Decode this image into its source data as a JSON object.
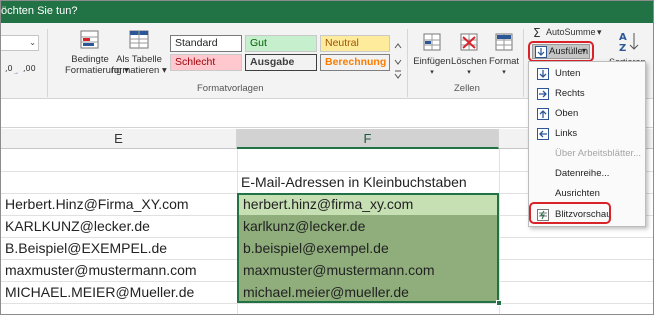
{
  "title_bar": {
    "tell_me_text": "öchten Sie tun?"
  },
  "ribbon": {
    "font_size_value": "",
    "number_format_buttons": [
      "⁰⁰→⁰",
      "⁰→⁰⁰"
    ],
    "conditional_formatting_label": "Bedingte\nFormatierung ▾",
    "format_as_table_label": "Als Tabelle\nformatieren ▾",
    "cell_styles": {
      "standard": "Standard",
      "gut": "Gut",
      "neutral": "Neutral",
      "schlecht": "Schlecht",
      "ausgabe": "Ausgabe",
      "berechnung": "Berechnung"
    },
    "formatvorlagen_label": "Formatvorlagen",
    "insert_label": "Einfügen",
    "delete_label": "Löschen",
    "format_label": "Format",
    "zellen_label": "Zellen",
    "autosum_label": "AutoSumme",
    "fill_label": "Ausfüllen",
    "sort_label": "Sortieren un",
    "colors": {
      "excel_green": "#217346",
      "gut_bg": "#c6efce",
      "gut_text": "#006100",
      "neutral_bg": "#ffeb9c",
      "neutral_text": "#9c5700",
      "schlecht_bg": "#ffc7ce",
      "schlecht_text": "#9c0006",
      "ausgabe_bg": "#f2f2f2",
      "berechnung_bg": "#f2f2f2",
      "berechnung_text": "#fa7d00",
      "highlight_red": "#d9232a"
    }
  },
  "fill_menu": {
    "items": [
      {
        "label": "Unten",
        "icon": "arrow-down-icon",
        "disabled": false
      },
      {
        "label": "Rechts",
        "icon": "arrow-right-icon",
        "disabled": false
      },
      {
        "label": "Oben",
        "icon": "arrow-up-icon",
        "disabled": false
      },
      {
        "label": "Links",
        "icon": "arrow-left-icon",
        "disabled": false
      },
      {
        "label": "Über Arbeitsblätter...",
        "icon": "",
        "disabled": true
      },
      {
        "label": "Datenreihe...",
        "icon": "",
        "disabled": false
      },
      {
        "label": "Ausrichten",
        "icon": "",
        "disabled": false
      },
      {
        "label": "Blitzvorschau",
        "icon": "flash-fill-icon",
        "disabled": false
      }
    ]
  },
  "sheet": {
    "columns": [
      "E",
      "F"
    ],
    "header_f": "E-Mail-Adressen in Kleinbuchstaben",
    "rows": [
      {
        "e": "Herbert.Hinz@Firma_XY.com",
        "f": "herbert.hinz@firma_xy.com"
      },
      {
        "e": "KARLKUNZ@lecker.de",
        "f": "karlkunz@lecker.de"
      },
      {
        "e": "B.Beispiel@EXEMPEL.de",
        "f": "b.beispiel@exempel.de"
      },
      {
        "e": "maxmuster@mustermann.com",
        "f": "maxmuster@mustermann.com"
      },
      {
        "e": "MICHAEL.MEIER@Mueller.de",
        "f": "michael.meier@mueller.de"
      }
    ]
  }
}
